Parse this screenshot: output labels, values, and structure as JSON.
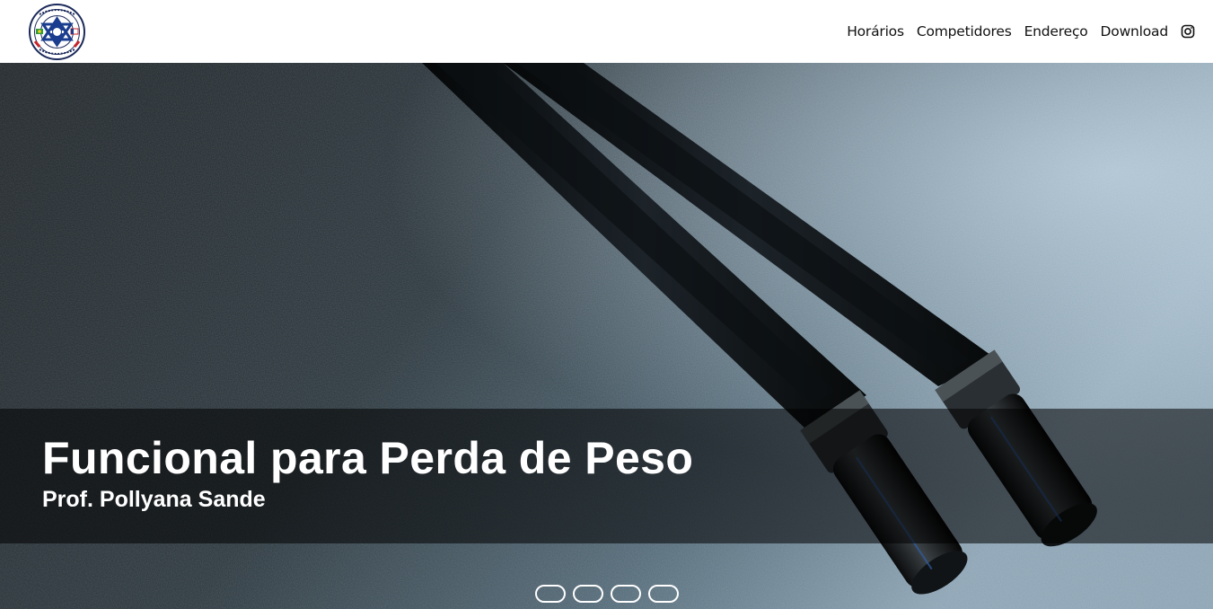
{
  "header": {
    "logo_name": "club-crest-logo",
    "nav": [
      {
        "label": "Horários"
      },
      {
        "label": "Competidores"
      },
      {
        "label": "Endereço"
      },
      {
        "label": "Download"
      }
    ],
    "instagram_icon": "instagram-icon"
  },
  "hero": {
    "title": "Funcional para Perda de Peso",
    "subtitle": "Prof. Pollyana Sande",
    "slide_count": 4,
    "active_slide": 1,
    "image_subject": "battle-ropes-on-gym-floor"
  },
  "colors": {
    "header_bg": "#ffffff",
    "nav_text": "#111111",
    "caption_band": "rgba(0,0,0,0.55)",
    "caption_text": "#ffffff",
    "logo_blue": "#1a3d8f",
    "logo_red": "#c8262a"
  }
}
